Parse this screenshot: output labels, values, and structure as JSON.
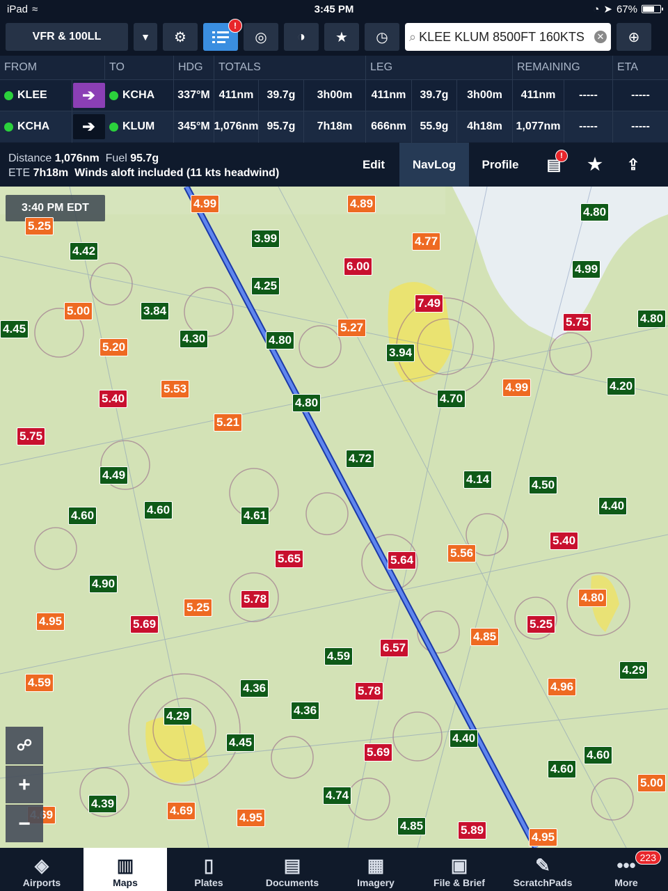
{
  "status": {
    "device": "iPad",
    "time": "3:45 PM",
    "battery": "67%",
    "battery_level": 0.67
  },
  "toolbar": {
    "layer": "VFR & 100LL",
    "route_badge": "!",
    "search_value": "KLEE KLUM 8500FT 160KTS"
  },
  "nav": {
    "headers": [
      "FROM",
      "TO",
      "HDG",
      "TOTALS",
      "LEG",
      "REMAINING",
      "ETA"
    ],
    "rows": [
      {
        "from": "KLEE",
        "to": "KCHA",
        "hdg": "337°M",
        "tot_dist": "411nm",
        "tot_fuel": "39.7g",
        "tot_time": "3h00m",
        "leg_dist": "411nm",
        "leg_fuel": "39.7g",
        "leg_time": "3h00m",
        "rem_dist": "411nm",
        "rem_a": "-----",
        "eta": "-----"
      },
      {
        "from": "KCHA",
        "to": "KLUM",
        "hdg": "345°M",
        "tot_dist": "1,076nm",
        "tot_fuel": "95.7g",
        "tot_time": "7h18m",
        "leg_dist": "666nm",
        "leg_fuel": "55.9g",
        "leg_time": "4h18m",
        "rem_dist": "1,077nm",
        "rem_a": "-----",
        "eta": "-----"
      }
    ]
  },
  "summary": {
    "distance_label": "Distance",
    "distance": "1,076nm",
    "fuel_label": "Fuel",
    "fuel": "95.7g",
    "ete_label": "ETE",
    "ete": "7h18m",
    "winds": "Winds aloft included (11 kts headwind)",
    "edit": "Edit",
    "navlog": "NavLog",
    "profile": "Profile",
    "alert_badge": "!"
  },
  "map": {
    "time": "3:40 PM EDT",
    "colors": {
      "green": "#0f5a18",
      "orange": "#ee6a22",
      "red": "#c8102e",
      "route": "#3a66d8"
    },
    "fuel_prices": [
      {
        "v": "4.99",
        "c": "orange"
      },
      {
        "v": "4.89",
        "c": "orange"
      },
      {
        "v": "4.80",
        "c": "green"
      },
      {
        "v": "5.25",
        "c": "orange"
      },
      {
        "v": "3.99",
        "c": "green"
      },
      {
        "v": "4.77",
        "c": "orange"
      },
      {
        "v": "4.42",
        "c": "green"
      },
      {
        "v": "6.00",
        "c": "red"
      },
      {
        "v": "4.99",
        "c": "green"
      },
      {
        "v": "4.25",
        "c": "green"
      },
      {
        "v": "7.49",
        "c": "red"
      },
      {
        "v": "5.00",
        "c": "orange"
      },
      {
        "v": "3.84",
        "c": "green"
      },
      {
        "v": "5.75",
        "c": "red"
      },
      {
        "v": "4.80",
        "c": "green"
      },
      {
        "v": "5.27",
        "c": "orange"
      },
      {
        "v": "4.45",
        "c": "green"
      },
      {
        "v": "4.30",
        "c": "green"
      },
      {
        "v": "4.80",
        "c": "green"
      },
      {
        "v": "5.20",
        "c": "orange"
      },
      {
        "v": "3.94",
        "c": "green"
      },
      {
        "v": "5.53",
        "c": "orange"
      },
      {
        "v": "4.99",
        "c": "orange"
      },
      {
        "v": "4.20",
        "c": "green"
      },
      {
        "v": "5.40",
        "c": "red"
      },
      {
        "v": "4.80",
        "c": "green"
      },
      {
        "v": "4.70",
        "c": "green"
      },
      {
        "v": "5.21",
        "c": "orange"
      },
      {
        "v": "5.75",
        "c": "red"
      },
      {
        "v": "4.72",
        "c": "green"
      },
      {
        "v": "4.49",
        "c": "green"
      },
      {
        "v": "4.14",
        "c": "green"
      },
      {
        "v": "4.50",
        "c": "green"
      },
      {
        "v": "4.60",
        "c": "green"
      },
      {
        "v": "4.60",
        "c": "green"
      },
      {
        "v": "4.61",
        "c": "green"
      },
      {
        "v": "4.40",
        "c": "green"
      },
      {
        "v": "5.65",
        "c": "red"
      },
      {
        "v": "5.64",
        "c": "red"
      },
      {
        "v": "5.56",
        "c": "orange"
      },
      {
        "v": "5.40",
        "c": "red"
      },
      {
        "v": "4.90",
        "c": "green"
      },
      {
        "v": "5.78",
        "c": "red"
      },
      {
        "v": "4.80",
        "c": "orange"
      },
      {
        "v": "4.95",
        "c": "orange"
      },
      {
        "v": "5.69",
        "c": "red"
      },
      {
        "v": "5.25",
        "c": "orange"
      },
      {
        "v": "4.85",
        "c": "orange"
      },
      {
        "v": "5.25",
        "c": "red"
      },
      {
        "v": "6.57",
        "c": "red"
      },
      {
        "v": "4.59",
        "c": "green"
      },
      {
        "v": "4.29",
        "c": "green"
      },
      {
        "v": "4.59",
        "c": "orange"
      },
      {
        "v": "4.96",
        "c": "orange"
      },
      {
        "v": "4.36",
        "c": "green"
      },
      {
        "v": "5.78",
        "c": "red"
      },
      {
        "v": "4.36",
        "c": "green"
      },
      {
        "v": "4.29",
        "c": "green"
      },
      {
        "v": "4.40",
        "c": "green"
      },
      {
        "v": "4.45",
        "c": "green"
      },
      {
        "v": "5.69",
        "c": "red"
      },
      {
        "v": "4.60",
        "c": "green"
      },
      {
        "v": "4.60",
        "c": "green"
      },
      {
        "v": "4.74",
        "c": "green"
      },
      {
        "v": "5.00",
        "c": "orange"
      },
      {
        "v": "4.39",
        "c": "green"
      },
      {
        "v": "4.69",
        "c": "orange"
      },
      {
        "v": "4.95",
        "c": "orange"
      },
      {
        "v": "4.69",
        "c": "orange"
      },
      {
        "v": "4.85",
        "c": "green"
      },
      {
        "v": "5.89",
        "c": "red"
      },
      {
        "v": "4.95",
        "c": "orange"
      }
    ]
  },
  "tabs": [
    {
      "label": "Airports",
      "icon": "airports-icon"
    },
    {
      "label": "Maps",
      "icon": "maps-icon"
    },
    {
      "label": "Plates",
      "icon": "plates-icon"
    },
    {
      "label": "Documents",
      "icon": "documents-icon"
    },
    {
      "label": "Imagery",
      "icon": "imagery-icon"
    },
    {
      "label": "File & Brief",
      "icon": "file-brief-icon"
    },
    {
      "label": "ScratchPads",
      "icon": "scratchpads-icon"
    },
    {
      "label": "More",
      "icon": "more-icon",
      "badge": "223"
    }
  ]
}
